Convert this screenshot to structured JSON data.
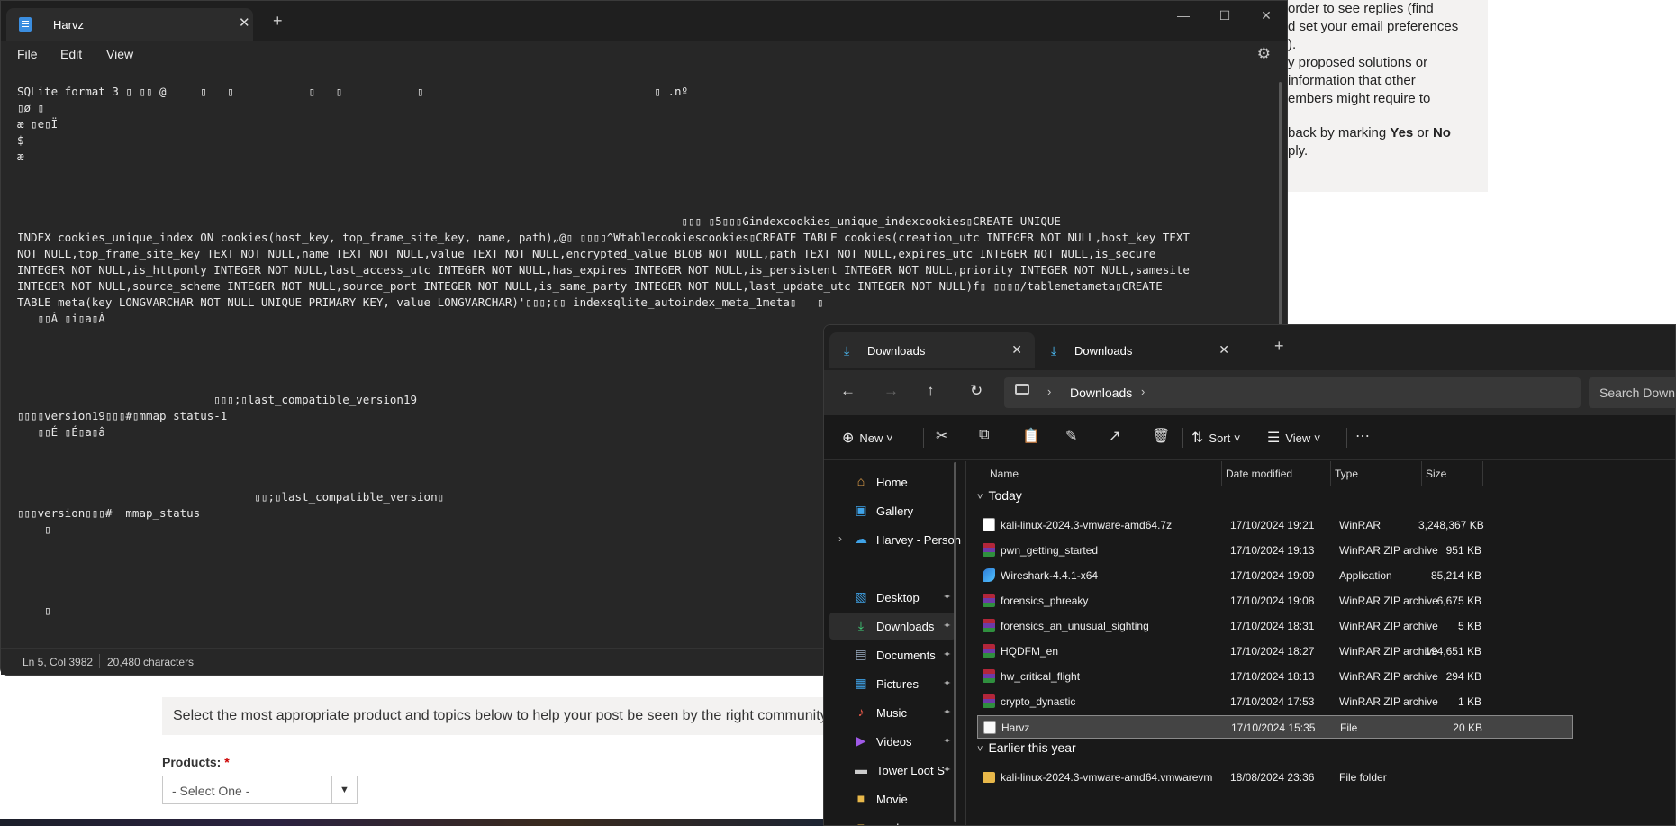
{
  "background_page": {
    "right_panel_lines": [
      {
        "text": "order to see replies (find"
      },
      {
        "text": "d set your email preferences"
      },
      {
        "text": ")."
      },
      {
        "text": "y proposed solutions or"
      },
      {
        "text": "information that other"
      },
      {
        "text": "embers might require to"
      },
      {
        "pre": "back by marking ",
        "b1": "Yes",
        "mid": " or ",
        "b2": "No"
      },
      {
        "text": "ply."
      }
    ],
    "select_prompt": "Select the most appropriate product and topics below to help your post be seen by the right community expe",
    "products_label": "Products:",
    "products_required": "*",
    "products_select_value": "- Select One -"
  },
  "notepad": {
    "tab_title": "Harvz",
    "menu": {
      "file": "File",
      "edit": "Edit",
      "view": "View"
    },
    "content_lines": [
      "SQLite format 3 ▯ ▯▯ @     ▯   ▯           ▯   ▯           ▯                                  ▯ .nº",
      "▯ø ▯",
      "æ ▯e▯Ï",
      "$",
      "æ",
      "",
      "",
      "",
      "                                                                                                  ▯▯▯ ▯5▯▯▯Gindexcookies_unique_indexcookies▯CREATE UNIQUE",
      "INDEX cookies_unique_index ON cookies(host_key, top_frame_site_key, name, path)„@▯ ▯▯▯▯^Wtablecookiescookies▯CREATE TABLE cookies(creation_utc INTEGER NOT NULL,host_key TEXT",
      "NOT NULL,top_frame_site_key TEXT NOT NULL,name TEXT NOT NULL,value TEXT NOT NULL,encrypted_value BLOB NOT NULL,path TEXT NOT NULL,expires_utc INTEGER NOT NULL,is_secure",
      "INTEGER NOT NULL,is_httponly INTEGER NOT NULL,last_access_utc INTEGER NOT NULL,has_expires INTEGER NOT NULL,is_persistent INTEGER NOT NULL,priority INTEGER NOT NULL,samesite",
      "INTEGER NOT NULL,source_scheme INTEGER NOT NULL,source_port INTEGER NOT NULL,is_same_party INTEGER NOT NULL,last_update_utc INTEGER NOT NULL)f▯ ▯▯▯▯/tablemetameta▯CREATE",
      "TABLE meta(key LONGVARCHAR NOT NULL UNIQUE PRIMARY KEY, value LONGVARCHAR)'▯▯▯;▯▯ indexsqlite_autoindex_meta_1meta▯   ▯",
      "   ▯▯Â ▯i▯a▯Â",
      "",
      "",
      "",
      "",
      "                             ▯▯▯;▯last_compatible_version19",
      "▯▯▯▯version19▯▯▯#▯mmap_status-1",
      "   ▯▯É ▯É▯a▯â",
      "",
      "",
      "",
      "                                   ▯▯;▯last_compatible_version▯",
      "▯▯▯version▯▯▯#  mmap_status",
      "    ▯",
      "",
      "",
      "",
      "",
      "    ▯"
    ],
    "status": {
      "position": "Ln 5, Col 3982",
      "characters": "20,480 characters"
    }
  },
  "explorer": {
    "tabs": [
      {
        "label": "Downloads",
        "active": true
      },
      {
        "label": "Downloads",
        "active": false
      }
    ],
    "address_crumb": "Downloads",
    "search_placeholder": "Search Downl",
    "toolbar": {
      "new": "New",
      "sort": "Sort",
      "view": "View"
    },
    "sidebar": [
      {
        "label": "Home",
        "icon": "home-icon"
      },
      {
        "label": "Gallery",
        "icon": "gallery-icon"
      },
      {
        "label": "Harvey - Person",
        "icon": "onedrive-icon"
      },
      {
        "label": "Desktop",
        "icon": "desktop-icon",
        "pinned": true
      },
      {
        "label": "Downloads",
        "icon": "download-icon",
        "pinned": true,
        "selected": true
      },
      {
        "label": "Documents",
        "icon": "documents-icon",
        "pinned": true
      },
      {
        "label": "Pictures",
        "icon": "pictures-icon",
        "pinned": true
      },
      {
        "label": "Music",
        "icon": "music-icon",
        "pinned": true
      },
      {
        "label": "Videos",
        "icon": "videos-icon",
        "pinned": true
      },
      {
        "label": "Tower Loot S",
        "icon": "drive-icon",
        "pinned": true
      },
      {
        "label": "Movie",
        "icon": "folder-icon"
      },
      {
        "label": "mods",
        "icon": "folder-icon"
      }
    ],
    "columns": {
      "name": "Name",
      "date": "Date modified",
      "type": "Type",
      "size": "Size"
    },
    "groups": [
      {
        "label": "Today",
        "files": [
          {
            "name": "kali-linux-2024.3-vmware-amd64.7z",
            "date": "17/10/2024 19:21",
            "type": "WinRAR",
            "size": "3,248,367 KB",
            "icon": "archive7z"
          },
          {
            "name": "pwn_getting_started",
            "date": "17/10/2024 19:13",
            "type": "WinRAR ZIP archive",
            "size": "951 KB",
            "icon": "winrar"
          },
          {
            "name": "Wireshark-4.4.1-x64",
            "date": "17/10/2024 19:09",
            "type": "Application",
            "size": "85,214 KB",
            "icon": "app"
          },
          {
            "name": "forensics_phreaky",
            "date": "17/10/2024 19:08",
            "type": "WinRAR ZIP archive",
            "size": "6,675 KB",
            "icon": "winrar"
          },
          {
            "name": "forensics_an_unusual_sighting",
            "date": "17/10/2024 18:31",
            "type": "WinRAR ZIP archive",
            "size": "5 KB",
            "icon": "winrar"
          },
          {
            "name": "HQDFM_en",
            "date": "17/10/2024 18:27",
            "type": "WinRAR ZIP archive",
            "size": "194,651 KB",
            "icon": "winrar"
          },
          {
            "name": "hw_critical_flight",
            "date": "17/10/2024 18:13",
            "type": "WinRAR ZIP archive",
            "size": "294 KB",
            "icon": "winrar"
          },
          {
            "name": "crypto_dynastic",
            "date": "17/10/2024 17:53",
            "type": "WinRAR ZIP archive",
            "size": "1 KB",
            "icon": "winrar"
          },
          {
            "name": "Harvz",
            "date": "17/10/2024 15:35",
            "type": "File",
            "size": "20 KB",
            "icon": "file",
            "selected": true
          }
        ]
      },
      {
        "label": "Earlier this year",
        "files": [
          {
            "name": "kali-linux-2024.3-vmware-amd64.vmwarevm",
            "date": "18/08/2024 23:36",
            "type": "File folder",
            "size": "",
            "icon": "folder"
          }
        ]
      }
    ]
  }
}
